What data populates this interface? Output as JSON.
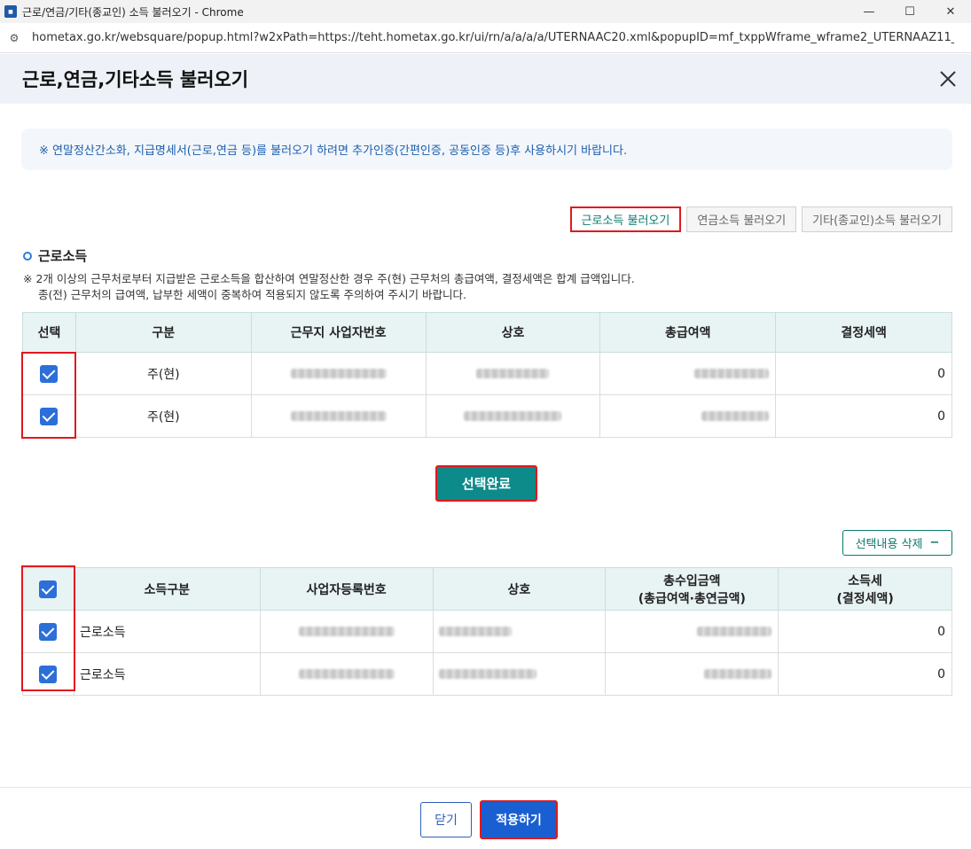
{
  "window": {
    "title": "근로/연금/기타(종교인) 소득 불러오기 - Chrome",
    "url": "hometax.go.kr/websquare/popup.html?w2xPath=https://teht.hometax.go.kr/ui/rn/a/a/a/a/UTERNAAC20.xml&popupID=mf_txppWframe_wframe2_UTERNAAZ11_U..."
  },
  "header": {
    "title": "근로,연금,기타소득 불러오기"
  },
  "notice": "※ 연말정산간소화, 지급명세서(근로,연금 등)를 불러오기 하려면 추가인증(간편인증, 공동인증 등)후 사용하시기 바랍니다.",
  "tabs": [
    "근로소득 불러오기",
    "연금소득 불러오기",
    "기타(종교인)소득 불러오기"
  ],
  "section": {
    "title": "근로소득"
  },
  "desc": {
    "line1": "※ 2개 이상의 근무처로부터 지급받은 근로소득을 합산하여 연말정산한 경우 주(현) 근무처의 총급여액, 결정세액은 합계 급액입니다.",
    "line2": "종(전) 근무처의 급여액, 납부한 세액이 중복하여 적용되지 않도록 주의하여 주시기 바랍니다."
  },
  "table1": {
    "headers": [
      "선택",
      "구분",
      "근무지 사업자번호",
      "상호",
      "총급여액",
      "결정세액"
    ],
    "rows": [
      {
        "type": "주(현)",
        "tax": "0"
      },
      {
        "type": "주(현)",
        "tax": "0"
      }
    ]
  },
  "buttons": {
    "select_done": "선택완료",
    "delete": "선택내용 삭제",
    "close": "닫기",
    "apply": "적용하기"
  },
  "table2": {
    "headers": [
      "소득구분",
      "사업자등록번호",
      "상호"
    ],
    "header_income_line1": "총수입금액",
    "header_income_line2": "(총급여액·총연금액)",
    "header_tax_line1": "소득세",
    "header_tax_line2": "(결정세액)",
    "rows": [
      {
        "category": "근로소득",
        "tax": "0"
      },
      {
        "category": "근로소득",
        "tax": "0"
      }
    ]
  }
}
